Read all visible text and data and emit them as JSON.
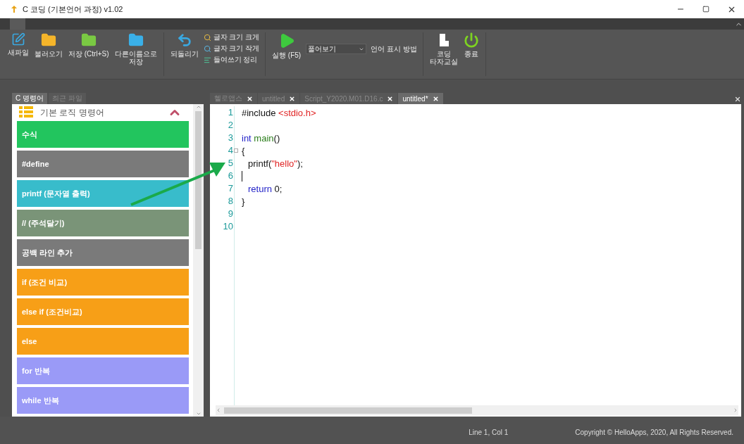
{
  "window": {
    "title": "C 코딩 (기본언어 과정) v1.02"
  },
  "toolbar": {
    "groups": [
      {
        "buttons": [
          {
            "kind": "new",
            "lines": [
              "새파일"
            ]
          },
          {
            "kind": "open",
            "lines": [
              "불러오기"
            ]
          },
          {
            "kind": "save",
            "lines": [
              "저장 (Ctrl+S)"
            ]
          },
          {
            "kind": "saveas",
            "lines": [
              "다른이름으로",
              "저장"
            ]
          }
        ]
      },
      {
        "buttons": [
          {
            "kind": "undo",
            "lines": [
              "되돌리기"
            ]
          }
        ],
        "small_buttons": [
          {
            "kind": "zoomin",
            "label": "글자 크기 크게"
          },
          {
            "kind": "zoomout",
            "label": "글자 크기 작게"
          },
          {
            "kind": "indent",
            "label": "들여쓰기 정리"
          }
        ]
      },
      {
        "buttons": [
          {
            "kind": "run",
            "lines": [
              "실행 (F5)"
            ]
          }
        ],
        "dropdown": {
          "value": "풀어보기",
          "label": "언어 표시 방법"
        }
      },
      {
        "buttons": [
          {
            "kind": "typing",
            "lines": [
              "코딩",
              "타자교실"
            ]
          },
          {
            "kind": "exit",
            "lines": [
              "종료"
            ]
          }
        ]
      }
    ]
  },
  "side_tabs": [
    {
      "label": "C 명령어",
      "selected": true
    },
    {
      "label": "최근 파일",
      "selected": false
    }
  ],
  "category": {
    "title": "기본 로직 명령어",
    "expanded": true
  },
  "commands": [
    {
      "label": "수식",
      "color": "#22c55e"
    },
    {
      "label": "#define",
      "color": "#7a7a7a"
    },
    {
      "label": "printf (문자열 출력)",
      "color": "#38bccb"
    },
    {
      "label": "// (주석달기)",
      "color": "#7a9478"
    },
    {
      "label": "공백 라인 추가",
      "color": "#7a7a7a"
    },
    {
      "label": "if (조건 비교)",
      "color": "#f79f17"
    },
    {
      "label": "else if (조건비교)",
      "color": "#f79f17"
    },
    {
      "label": "else",
      "color": "#f79f17"
    },
    {
      "label": "for 반복",
      "color": "#9a9af7"
    },
    {
      "label": "while 반복",
      "color": "#9a9af7"
    }
  ],
  "editor_tabs": [
    {
      "label": "헬로앱스",
      "selected": false
    },
    {
      "label": "untitled",
      "selected": false
    },
    {
      "label": "Script_Y2020.M01.D16.c",
      "selected": false
    },
    {
      "label": "untitled*",
      "selected": true
    }
  ],
  "editor": {
    "lines": [
      {
        "number": "1",
        "tokens": [
          {
            "kind": "plain",
            "text": "#include "
          },
          {
            "kind": "string",
            "text": "<stdio.h>"
          }
        ]
      },
      {
        "number": "2"
      },
      {
        "number": "3",
        "tokens": [
          {
            "kind": "keyword",
            "text": "int"
          },
          {
            "kind": "function",
            "text": "main"
          },
          {
            "kind": "plain",
            "text": "()"
          }
        ]
      },
      {
        "number": "4",
        "fold": true,
        "tokens": [
          {
            "kind": "plain",
            "text": "{"
          }
        ]
      },
      {
        "number": "5",
        "indented": true,
        "tokens": [
          {
            "kind": "plain",
            "text": "printf("
          },
          {
            "kind": "string",
            "text": "\"hello\""
          },
          {
            "kind": "plain",
            "text": ");"
          }
        ]
      },
      {
        "number": "6",
        "caret": true
      },
      {
        "number": "7",
        "indented": true,
        "tokens": [
          {
            "kind": "keyword",
            "text": "return"
          },
          {
            "kind": "plain",
            "text": "0;"
          }
        ]
      },
      {
        "number": "8",
        "tokens": [
          {
            "kind": "plain",
            "text": "}"
          }
        ]
      },
      {
        "number": "9"
      },
      {
        "number": "10"
      }
    ]
  },
  "status_bar": {
    "position": "Line 1, Col 1",
    "copyright": "Copyright © HelloApps, 2020, All Rights Reserved."
  }
}
